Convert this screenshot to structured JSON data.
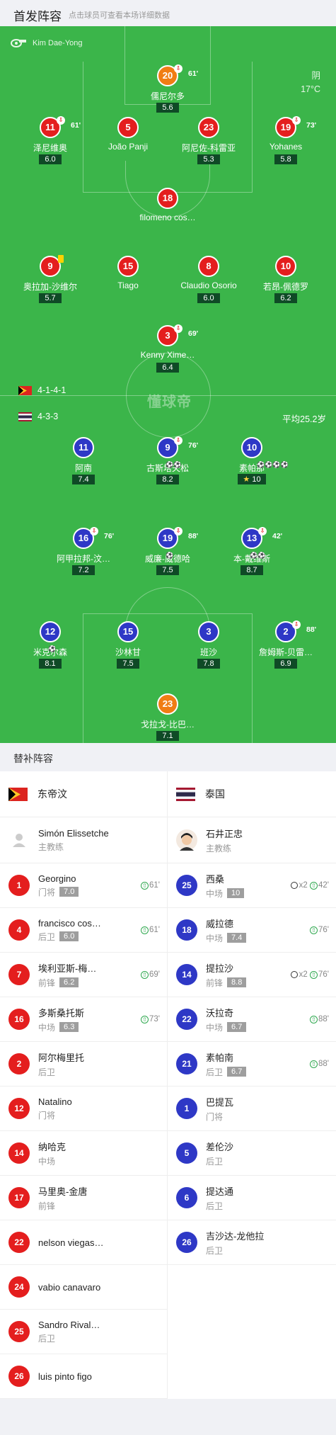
{
  "header": {
    "title": "首发阵容",
    "subtitle": "点击球员可查看本场详细数据"
  },
  "referee": {
    "name": "Kim Dae-Yong"
  },
  "weather": {
    "condition": "阴",
    "temperature": "17°C"
  },
  "watermark": "懂球帝",
  "home": {
    "formation": "4-1-4-1",
    "team": "东帝汶"
  },
  "away": {
    "formation": "4-3-3",
    "avg_age": "平均25.2岁",
    "team": "泰国"
  },
  "home_lineup": [
    {
      "number": "20",
      "name": "儒尼尔多",
      "rating": "5.6",
      "sub_min": "61'",
      "color": "orange"
    },
    {
      "number": "11",
      "name": "泽尼维奥",
      "rating": "6.0",
      "sub_min": "61'",
      "color": "red"
    },
    {
      "number": "5",
      "name": "João Panji",
      "rating": "",
      "color": "red"
    },
    {
      "number": "23",
      "name": "阿尼佐-科雷亚",
      "rating": "5.3",
      "color": "red"
    },
    {
      "number": "19",
      "name": "Yohanes",
      "rating": "5.8",
      "sub_min": "73'",
      "color": "red"
    },
    {
      "number": "18",
      "name": "filomeno cos…",
      "rating": "",
      "color": "red"
    },
    {
      "number": "9",
      "name": "奥拉加-沙维尔",
      "rating": "5.7",
      "yellow": true,
      "color": "red"
    },
    {
      "number": "15",
      "name": "Tiago",
      "rating": "",
      "color": "red"
    },
    {
      "number": "8",
      "name": "Claudio Osorio",
      "rating": "6.0",
      "color": "red"
    },
    {
      "number": "10",
      "name": "若昂-佩德罗",
      "rating": "6.2",
      "color": "red"
    },
    {
      "number": "3",
      "name": "Kenny Xime…",
      "rating": "6.4",
      "sub_min": "69'",
      "color": "red"
    }
  ],
  "away_lineup": [
    {
      "number": "11",
      "name": "阿南",
      "rating": "7.4",
      "color": "blue"
    },
    {
      "number": "9",
      "name": "古斯塔夫松",
      "rating": "8.2",
      "sub_min": "76'",
      "color": "blue"
    },
    {
      "number": "10",
      "name": "素帕那",
      "rating": "10",
      "star": true,
      "color": "blue"
    },
    {
      "number": "16",
      "name": "阿甲拉邦-汶…",
      "rating": "7.2",
      "sub_min": "76'",
      "color": "blue"
    },
    {
      "number": "19",
      "name": "威廉-威德哈",
      "rating": "7.5",
      "sub_min": "88'",
      "color": "blue"
    },
    {
      "number": "13",
      "name": "本-戴维斯",
      "rating": "8.7",
      "sub_min": "42'",
      "color": "blue"
    },
    {
      "number": "12",
      "name": "米克尔森",
      "rating": "8.1",
      "color": "blue"
    },
    {
      "number": "15",
      "name": "沙林甘",
      "rating": "7.5",
      "color": "blue"
    },
    {
      "number": "3",
      "name": "班沙",
      "rating": "7.8",
      "color": "blue"
    },
    {
      "number": "2",
      "name": "詹姆斯-贝雷…",
      "rating": "6.9",
      "sub_min": "88'",
      "color": "blue"
    },
    {
      "number": "23",
      "name": "戈拉戈-比巴…",
      "rating": "7.1",
      "color": "orange"
    }
  ],
  "subs": {
    "title": "替补阵容",
    "home_coach": {
      "name": "Simón Elissetche",
      "role": "主教练"
    },
    "away_coach": {
      "name": "石井正忠",
      "role": "主教练"
    },
    "home": [
      {
        "number": "1",
        "name": "Georgino",
        "pos": "门将",
        "rating": "7.0",
        "event": "61'"
      },
      {
        "number": "4",
        "name": "francisco cos…",
        "pos": "后卫",
        "rating": "6.0",
        "event": "61'"
      },
      {
        "number": "7",
        "name": "埃利亚斯-梅…",
        "pos": "前锋",
        "rating": "6.2",
        "event": "69'"
      },
      {
        "number": "16",
        "name": "多斯桑托斯",
        "pos": "中场",
        "rating": "6.3",
        "event": "73'"
      },
      {
        "number": "2",
        "name": "阿尔梅里托",
        "pos": "后卫",
        "rating": "",
        "event": ""
      },
      {
        "number": "12",
        "name": "Natalino",
        "pos": "门将",
        "rating": "",
        "event": ""
      },
      {
        "number": "14",
        "name": "纳哈克",
        "pos": "中场",
        "rating": "",
        "event": ""
      },
      {
        "number": "17",
        "name": "马里奥-金唐",
        "pos": "前锋",
        "rating": "",
        "event": ""
      },
      {
        "number": "22",
        "name": "nelson viegas…",
        "pos": "",
        "rating": "",
        "event": ""
      },
      {
        "number": "24",
        "name": "vabio canavaro",
        "pos": "",
        "rating": "",
        "event": ""
      },
      {
        "number": "25",
        "name": "Sandro Rival…",
        "pos": "后卫",
        "rating": "",
        "event": ""
      },
      {
        "number": "26",
        "name": "luis pinto figo",
        "pos": "",
        "rating": "",
        "event": ""
      }
    ],
    "away": [
      {
        "number": "25",
        "name": "西桑",
        "pos": "中场",
        "rating": "10",
        "goals": "x2",
        "event": "42'"
      },
      {
        "number": "18",
        "name": "威拉德",
        "pos": "中场",
        "rating": "7.4",
        "event": "76'"
      },
      {
        "number": "14",
        "name": "提拉沙",
        "pos": "前锋",
        "rating": "8.8",
        "goals": "x2",
        "event": "76'"
      },
      {
        "number": "22",
        "name": "沃拉奇",
        "pos": "中场",
        "rating": "6.7",
        "event": "88'"
      },
      {
        "number": "21",
        "name": "素帕南",
        "pos": "后卫",
        "rating": "6.7",
        "event": "88'"
      },
      {
        "number": "1",
        "name": "巴提瓦",
        "pos": "门将",
        "rating": "",
        "event": ""
      },
      {
        "number": "5",
        "name": "差伦沙",
        "pos": "后卫",
        "rating": "",
        "event": ""
      },
      {
        "number": "6",
        "name": "提达通",
        "pos": "后卫",
        "rating": "",
        "event": ""
      },
      {
        "number": "26",
        "name": "吉沙达-龙他拉",
        "pos": "后卫",
        "rating": "",
        "event": ""
      }
    ]
  }
}
